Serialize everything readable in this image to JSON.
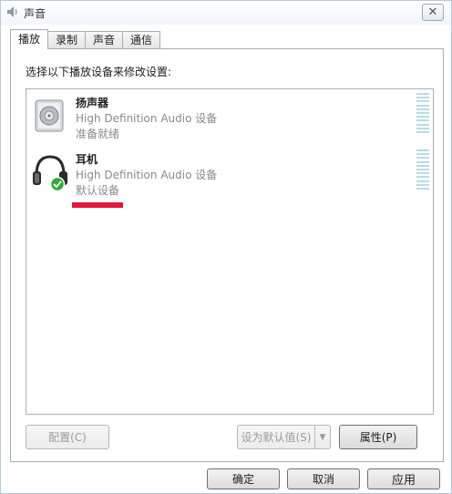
{
  "window": {
    "title": "声音",
    "close_glyph": "✕",
    "title_icon": "speaker-icon"
  },
  "tabs": [
    {
      "label": "播放",
      "active": true
    },
    {
      "label": "录制",
      "active": false
    },
    {
      "label": "声音",
      "active": false
    },
    {
      "label": "通信",
      "active": false
    }
  ],
  "panel": {
    "instruction": "选择以下播放设备来修改设置:"
  },
  "devices": [
    {
      "name": "扬声器",
      "description": "High Definition Audio 设备",
      "status": "准备就绪",
      "icon": "speaker-device-icon"
    },
    {
      "name": "耳机",
      "description": "High Definition Audio 设备",
      "status": "默认设备",
      "icon": "headphones-icon",
      "default_badge_icon": "check-icon"
    }
  ],
  "buttons": {
    "configure": "配置(C)",
    "set_default": "设为默认值(S)",
    "set_default_arrow": "▼",
    "properties": "属性(P)",
    "ok": "确定",
    "cancel": "取消",
    "apply": "应用"
  },
  "colors": {
    "accent_red": "#e2173a",
    "level_meter": "#b8dbe6",
    "default_check": "#2da936"
  }
}
